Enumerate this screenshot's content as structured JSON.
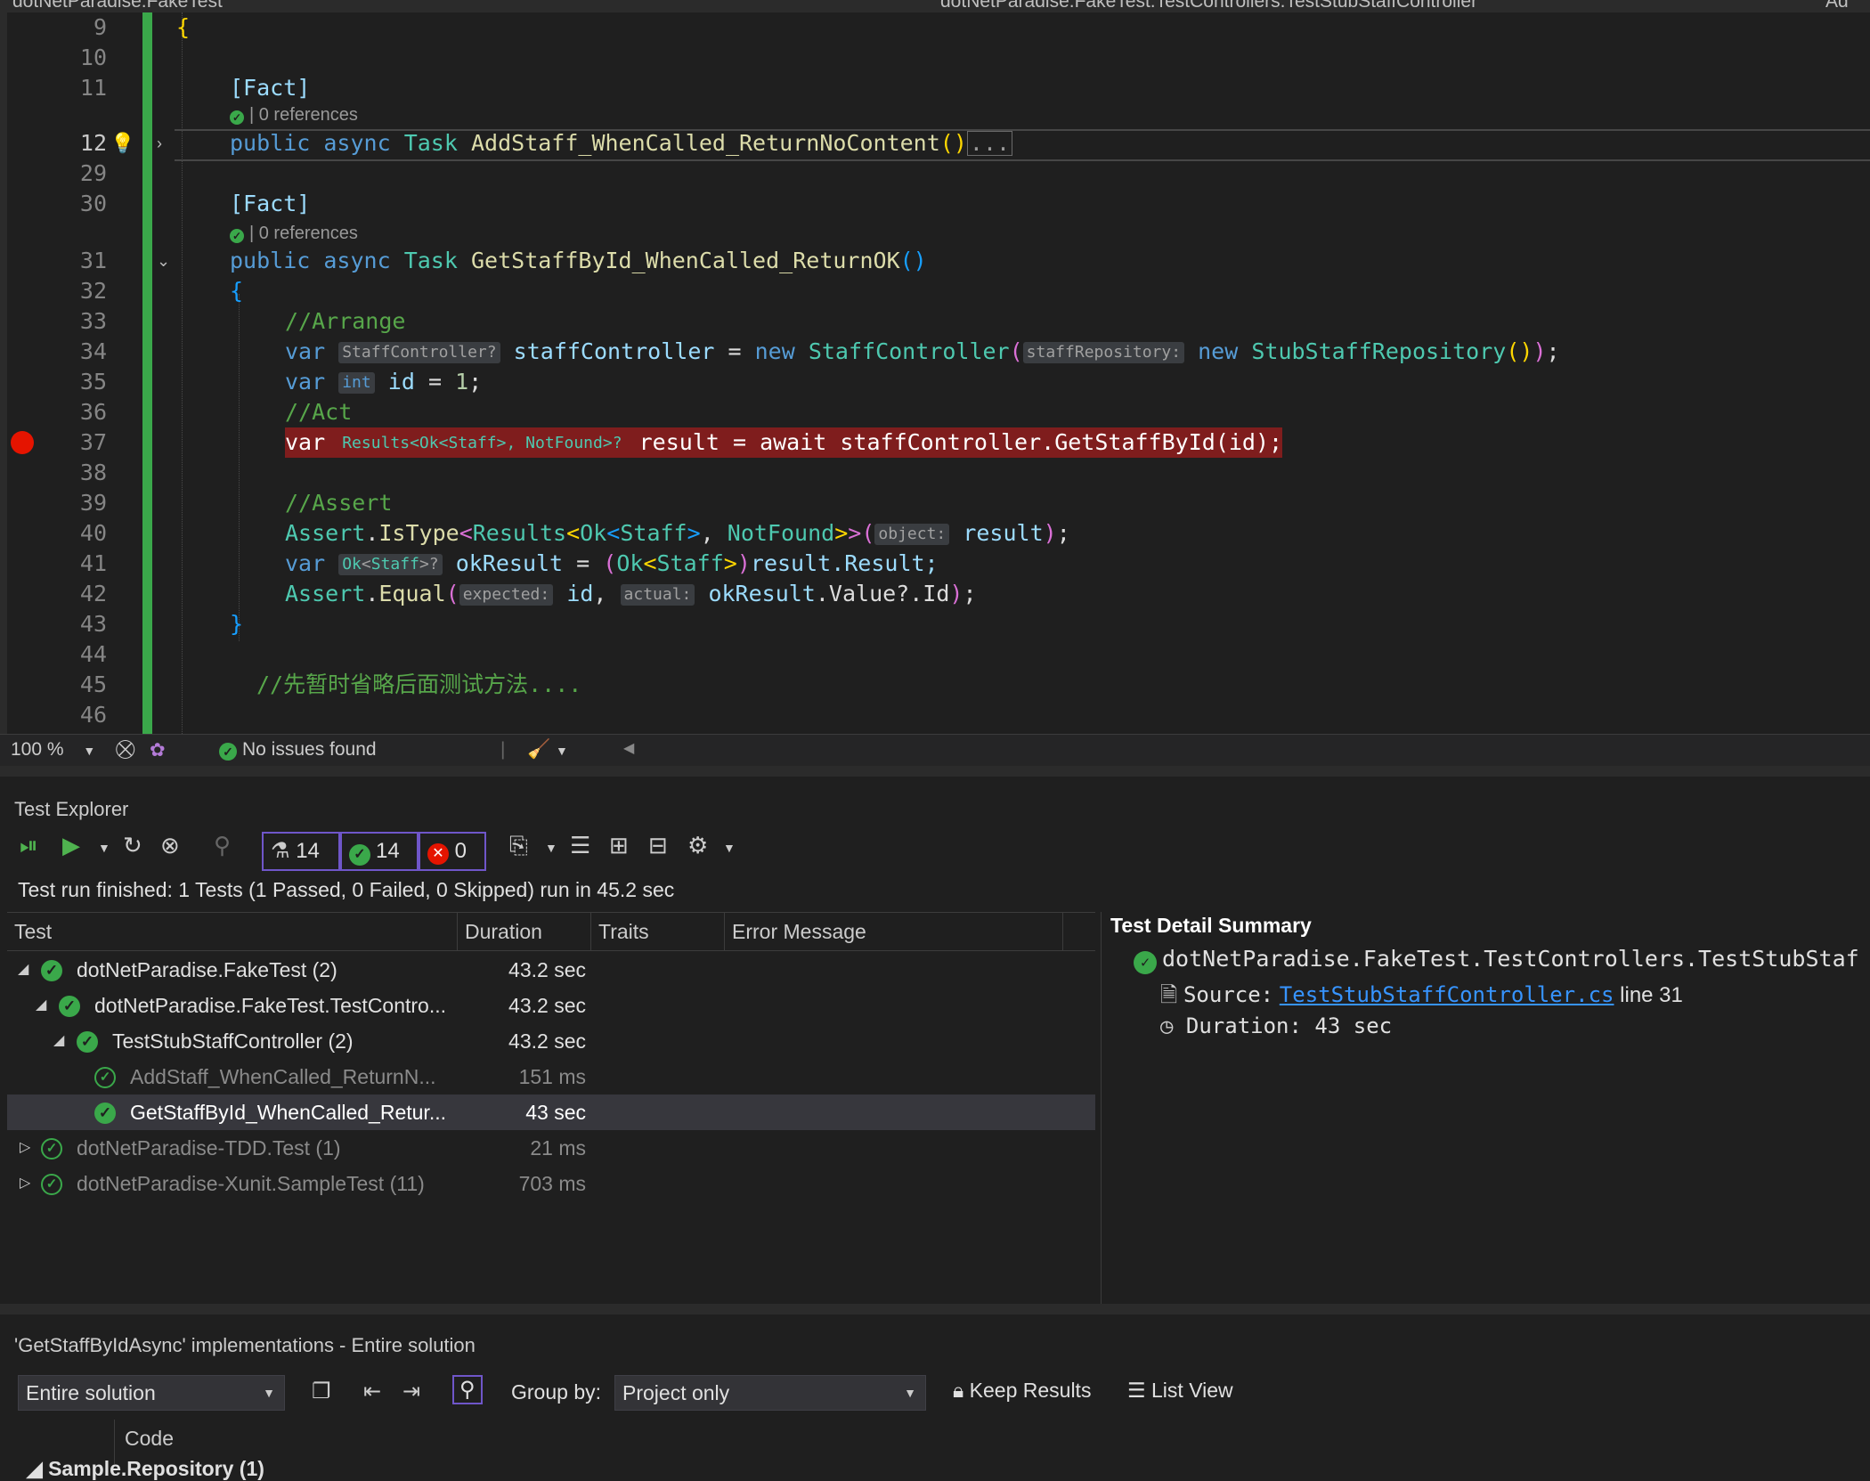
{
  "tabs": {
    "left": "dotNetParadise.FakeTest",
    "middle": "dotNetParadise.FakeTest.TestControllers.TestStubStaffController",
    "right": "Ad"
  },
  "editor": {
    "lines": {
      "l9": "9",
      "l10": "10",
      "l11": "11",
      "l12": "12",
      "l29": "29",
      "l30": "30",
      "l31": "31",
      "l32": "32",
      "l33": "33",
      "l34": "34",
      "l35": "35",
      "l36": "36",
      "l37": "37",
      "l38": "38",
      "l39": "39",
      "l40": "40",
      "l41": "41",
      "l42": "42",
      "l43": "43",
      "l44": "44",
      "l45": "45",
      "l46": "46"
    },
    "fact1": "[Fact]",
    "fact2": "[Fact]",
    "codelens1": "| 0 references",
    "codelens2": "| 0 references",
    "method1": {
      "kw1": "public",
      "kw2": "async",
      "type": "Task",
      "name": "AddStaff_WhenCalled_ReturnNoContent",
      "collapsed": "..."
    },
    "method2": {
      "kw1": "public",
      "kw2": "async",
      "type": "Task",
      "name": "GetStaffById_WhenCalled_ReturnOK"
    },
    "comment_arrange": "//Arrange",
    "comment_act": "//Act",
    "comment_assert": "//Assert",
    "line34": {
      "var": "var",
      "hint": "StaffController?",
      "name": "staffController",
      "new": "new",
      "type": "StaffController",
      "param_hint": "staffRepository:",
      "new2": "new",
      "type2": "StubStaffRepository"
    },
    "line35": {
      "var": "var",
      "hint": "int",
      "name": "id",
      "value": "1"
    },
    "line37": {
      "var": "var",
      "hint_results": "Results",
      "hint_ok": "Ok",
      "hint_staff": "Staff",
      "hint_notfound": "NotFound",
      "rest": "result = await staffController.GetStaffById(id);"
    },
    "line40": {
      "assert": "Assert",
      "method": "IsType",
      "results": "Results",
      "ok": "Ok",
      "staff": "Staff",
      "notfound": "NotFound",
      "hint": "object:",
      "arg": "result"
    },
    "line41": {
      "var": "var",
      "hint_ok": "Ok",
      "hint_staff": "Staff",
      "name": "okResult",
      "ok": "Ok",
      "staff": "Staff",
      "tail": "result.Result;"
    },
    "line42": {
      "assert": "Assert",
      "method": "Equal",
      "hint_expected": "expected:",
      "arg1": "id",
      "hint_actual": "actual:",
      "arg2": "okResult",
      "tail": ".Value?.Id"
    },
    "line45_comment": "//先暂时省略后面测试方法....",
    "open_brace": "{",
    "close_brace": "}"
  },
  "editor_status": {
    "zoom": "100 %",
    "issues": "No issues found"
  },
  "test_explorer": {
    "title": "Test Explorer",
    "counts": {
      "total": "14",
      "passed": "14",
      "failed": "0"
    },
    "summary": "Test run finished: 1 Tests (1 Passed, 0 Failed, 0 Skipped) run in 45.2 sec",
    "columns": {
      "test": "Test",
      "duration": "Duration",
      "traits": "Traits",
      "error": "Error Message"
    },
    "rows": [
      {
        "name": "dotNetParadise.FakeTest (2)",
        "duration": "43.2 sec"
      },
      {
        "name": "dotNetParadise.FakeTest.TestContro...",
        "duration": "43.2 sec"
      },
      {
        "name": "TestStubStaffController (2)",
        "duration": "43.2 sec"
      },
      {
        "name": "AddStaff_WhenCalled_ReturnN...",
        "duration": "151 ms"
      },
      {
        "name": "GetStaffById_WhenCalled_Retur...",
        "duration": "43 sec"
      },
      {
        "name": "dotNetParadise-TDD.Test (1)",
        "duration": "21 ms"
      },
      {
        "name": "dotNetParadise-Xunit.SampleTest (11)",
        "duration": "703 ms"
      }
    ],
    "detail": {
      "title": "Test Detail Summary",
      "test_name": "dotNetParadise.FakeTest.TestControllers.TestStubStaf",
      "source_label": "Source:",
      "source_link": "TestStubStaffController.cs",
      "source_line": "line 31",
      "duration_label": "Duration:",
      "duration_value": "43 sec"
    }
  },
  "implementations": {
    "title": "'GetStaffByIdAsync' implementations - Entire solution",
    "scope": "Entire solution",
    "group_by_label": "Group by:",
    "group_by_value": "Project only",
    "keep_results": "Keep Results",
    "list_view": "List View",
    "code_col": "Code",
    "first_group": "Sample.Repository (1)"
  }
}
